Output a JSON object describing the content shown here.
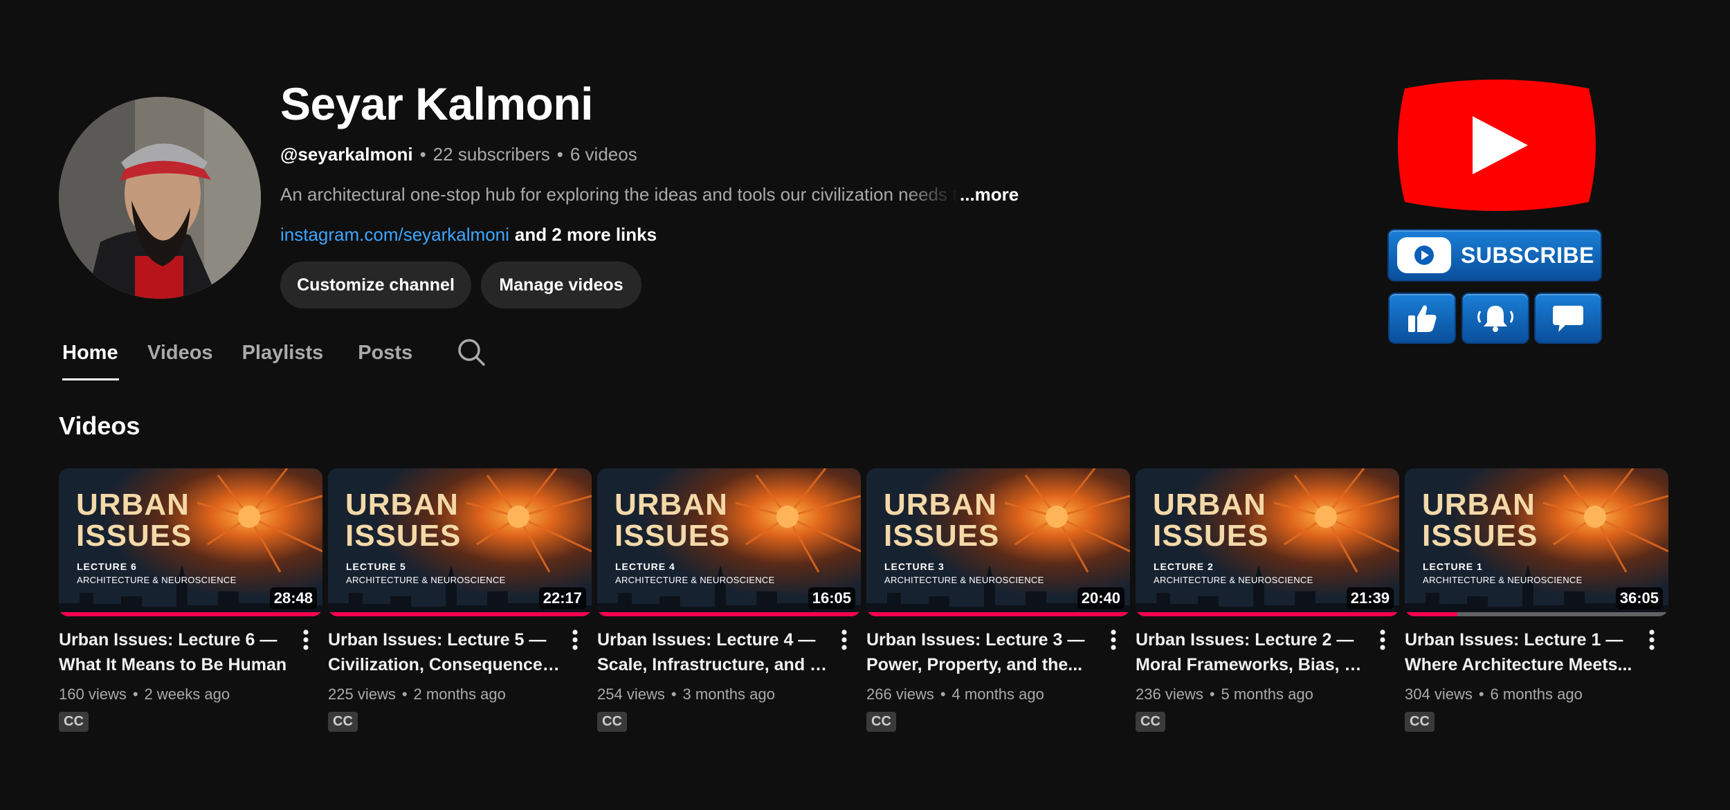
{
  "channel": {
    "name": "Seyar Kalmoni",
    "handle": "@seyarkalmoni",
    "subscribers": "22 subscribers",
    "videos_count": "6 videos",
    "separator": "•",
    "description": "An architectural one-stop hub for exploring the ideas and tools our civilization needs to",
    "description_more": "...more",
    "link": "instagram.com/seyarkalmoni",
    "more_links": "and 2 more links",
    "buttons": {
      "customize": "Customize channel",
      "manage": "Manage videos"
    }
  },
  "promo": {
    "subscribe_label": "SUBSCRIBE",
    "youtube_red": "#ff0000",
    "button_blue": "#1a7fd6"
  },
  "tabs": [
    {
      "label": "Home",
      "active": true
    },
    {
      "label": "Videos",
      "active": false
    },
    {
      "label": "Playlists",
      "active": false
    },
    {
      "label": "Posts",
      "active": false
    }
  ],
  "section": {
    "title": "Videos"
  },
  "thumbnail_text": {
    "title_line1": "URBAN",
    "title_line2": "ISSUES",
    "subtitle": "ARCHITECTURE & NEUROSCIENCE"
  },
  "videos": [
    {
      "lecture": "LECTURE 6",
      "duration": "28:48",
      "title_line1": "Urban Issues: Lecture 6 —",
      "title_line2": "What It Means to Be Human",
      "views": "160 views",
      "age": "2 weeks ago",
      "badge": "CC",
      "progress": 1.0
    },
    {
      "lecture": "LECTURE 5",
      "duration": "22:17",
      "title_line1": "Urban Issues: Lecture 5 —",
      "title_line2": "Civilization, Consequence,...",
      "views": "225 views",
      "age": "2 months ago",
      "badge": "CC",
      "progress": 1.0
    },
    {
      "lecture": "LECTURE 4",
      "duration": "16:05",
      "title_line1": "Urban Issues: Lecture 4 —",
      "title_line2": "Scale, Infrastructure, and th...",
      "views": "254 views",
      "age": "3 months ago",
      "badge": "CC",
      "progress": 1.0
    },
    {
      "lecture": "LECTURE 3",
      "duration": "20:40",
      "title_line1": "Urban Issues: Lecture 3 —",
      "title_line2": "Power, Property, and the...",
      "views": "266 views",
      "age": "4 months ago",
      "badge": "CC",
      "progress": 1.0
    },
    {
      "lecture": "LECTURE 2",
      "duration": "21:39",
      "title_line1": "Urban Issues: Lecture 2 —",
      "title_line2": "Moral Frameworks, Bias, an...",
      "views": "236 views",
      "age": "5 months ago",
      "badge": "CC",
      "progress": 1.0
    },
    {
      "lecture": "LECTURE 1",
      "duration": "36:05",
      "title_line1": "Urban Issues: Lecture 1 —",
      "title_line2": "Where Architecture Meets...",
      "views": "304 views",
      "age": "6 months ago",
      "badge": "CC",
      "progress": 0.2
    }
  ]
}
